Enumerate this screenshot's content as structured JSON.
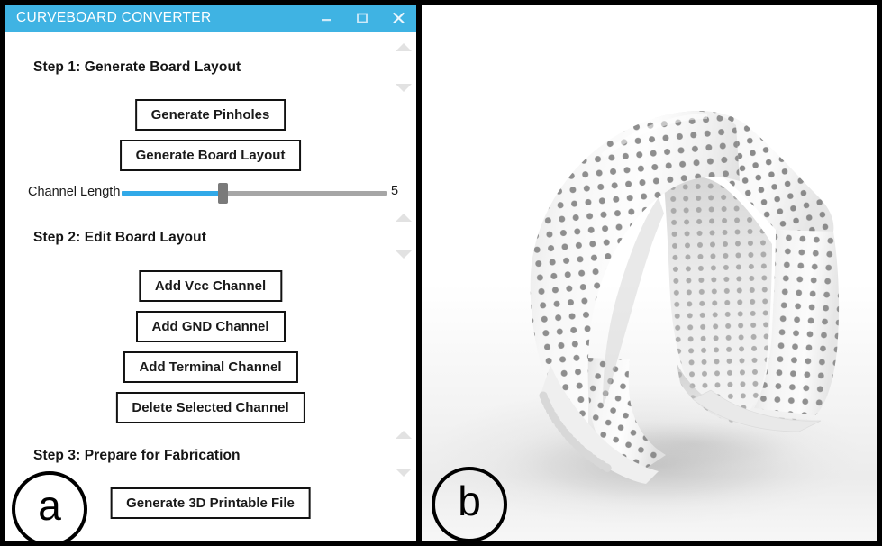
{
  "figure": {
    "panels": [
      {
        "id": "a",
        "label": "a"
      },
      {
        "id": "b",
        "label": "b"
      }
    ]
  },
  "window": {
    "title": "CURVEBOARD CONVERTER",
    "controls": {
      "minimize": "minimize-button",
      "maximize": "maximize-button",
      "close": "close-button"
    },
    "titlebar_color": "#3fb3e3",
    "accent_color": "#31a9e8"
  },
  "panel_a": {
    "steps": [
      {
        "heading": "Step 1: Generate Board Layout",
        "buttons": [
          "Generate Pinholes",
          "Generate Board Layout"
        ]
      },
      {
        "heading": "Step 2: Edit Board Layout",
        "buttons": [
          "Add Vcc Channel",
          "Add GND Channel",
          "Add Terminal Channel",
          "Delete Selected Channel"
        ]
      },
      {
        "heading": "Step 3: Prepare for Fabrication",
        "buttons": [
          "Generate 3D Printable File"
        ]
      }
    ],
    "slider": {
      "label": "Channel Length",
      "value": "5",
      "fill_percent": 38,
      "min": "0",
      "max": "5"
    },
    "scroll_arrows": [
      {
        "up": "scroll-up-icon",
        "down": "scroll-down-icon"
      },
      {
        "up": "scroll-up-icon",
        "down": "scroll-down-icon"
      },
      {
        "up": "scroll-up-icon",
        "down": "scroll-down-icon"
      }
    ]
  },
  "panel_b": {
    "description": "3D rendered curved wristband board with pinhole grid",
    "object_color": "#f2f2f2",
    "pinhole_color": "#8c8c8c"
  }
}
